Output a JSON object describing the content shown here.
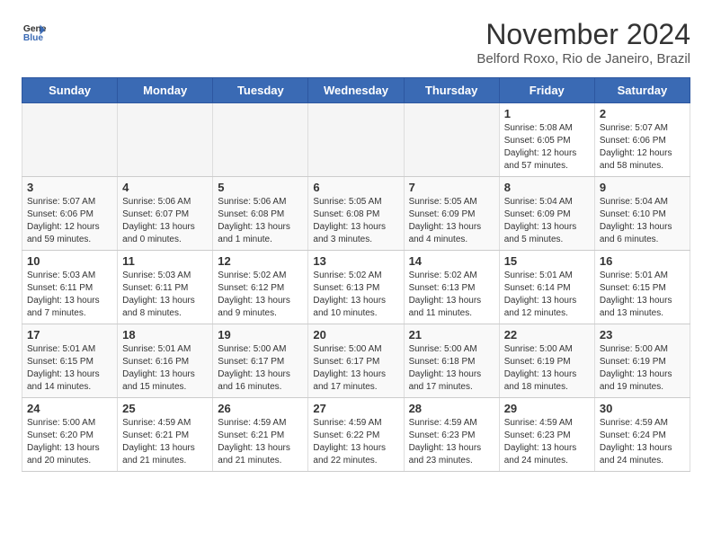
{
  "header": {
    "logo_line1": "General",
    "logo_line2": "Blue",
    "title": "November 2024",
    "subtitle": "Belford Roxo, Rio de Janeiro, Brazil"
  },
  "weekdays": [
    "Sunday",
    "Monday",
    "Tuesday",
    "Wednesday",
    "Thursday",
    "Friday",
    "Saturday"
  ],
  "weeks": [
    [
      {
        "day": "",
        "sunrise": "",
        "sunset": "",
        "daylight": "",
        "empty": true
      },
      {
        "day": "",
        "sunrise": "",
        "sunset": "",
        "daylight": "",
        "empty": true
      },
      {
        "day": "",
        "sunrise": "",
        "sunset": "",
        "daylight": "",
        "empty": true
      },
      {
        "day": "",
        "sunrise": "",
        "sunset": "",
        "daylight": "",
        "empty": true
      },
      {
        "day": "",
        "sunrise": "",
        "sunset": "",
        "daylight": "",
        "empty": true
      },
      {
        "day": "1",
        "sunrise": "Sunrise: 5:08 AM",
        "sunset": "Sunset: 6:05 PM",
        "daylight": "Daylight: 12 hours and 57 minutes.",
        "empty": false
      },
      {
        "day": "2",
        "sunrise": "Sunrise: 5:07 AM",
        "sunset": "Sunset: 6:06 PM",
        "daylight": "Daylight: 12 hours and 58 minutes.",
        "empty": false
      }
    ],
    [
      {
        "day": "3",
        "sunrise": "Sunrise: 5:07 AM",
        "sunset": "Sunset: 6:06 PM",
        "daylight": "Daylight: 12 hours and 59 minutes.",
        "empty": false
      },
      {
        "day": "4",
        "sunrise": "Sunrise: 5:06 AM",
        "sunset": "Sunset: 6:07 PM",
        "daylight": "Daylight: 13 hours and 0 minutes.",
        "empty": false
      },
      {
        "day": "5",
        "sunrise": "Sunrise: 5:06 AM",
        "sunset": "Sunset: 6:08 PM",
        "daylight": "Daylight: 13 hours and 1 minute.",
        "empty": false
      },
      {
        "day": "6",
        "sunrise": "Sunrise: 5:05 AM",
        "sunset": "Sunset: 6:08 PM",
        "daylight": "Daylight: 13 hours and 3 minutes.",
        "empty": false
      },
      {
        "day": "7",
        "sunrise": "Sunrise: 5:05 AM",
        "sunset": "Sunset: 6:09 PM",
        "daylight": "Daylight: 13 hours and 4 minutes.",
        "empty": false
      },
      {
        "day": "8",
        "sunrise": "Sunrise: 5:04 AM",
        "sunset": "Sunset: 6:09 PM",
        "daylight": "Daylight: 13 hours and 5 minutes.",
        "empty": false
      },
      {
        "day": "9",
        "sunrise": "Sunrise: 5:04 AM",
        "sunset": "Sunset: 6:10 PM",
        "daylight": "Daylight: 13 hours and 6 minutes.",
        "empty": false
      }
    ],
    [
      {
        "day": "10",
        "sunrise": "Sunrise: 5:03 AM",
        "sunset": "Sunset: 6:11 PM",
        "daylight": "Daylight: 13 hours and 7 minutes.",
        "empty": false
      },
      {
        "day": "11",
        "sunrise": "Sunrise: 5:03 AM",
        "sunset": "Sunset: 6:11 PM",
        "daylight": "Daylight: 13 hours and 8 minutes.",
        "empty": false
      },
      {
        "day": "12",
        "sunrise": "Sunrise: 5:02 AM",
        "sunset": "Sunset: 6:12 PM",
        "daylight": "Daylight: 13 hours and 9 minutes.",
        "empty": false
      },
      {
        "day": "13",
        "sunrise": "Sunrise: 5:02 AM",
        "sunset": "Sunset: 6:13 PM",
        "daylight": "Daylight: 13 hours and 10 minutes.",
        "empty": false
      },
      {
        "day": "14",
        "sunrise": "Sunrise: 5:02 AM",
        "sunset": "Sunset: 6:13 PM",
        "daylight": "Daylight: 13 hours and 11 minutes.",
        "empty": false
      },
      {
        "day": "15",
        "sunrise": "Sunrise: 5:01 AM",
        "sunset": "Sunset: 6:14 PM",
        "daylight": "Daylight: 13 hours and 12 minutes.",
        "empty": false
      },
      {
        "day": "16",
        "sunrise": "Sunrise: 5:01 AM",
        "sunset": "Sunset: 6:15 PM",
        "daylight": "Daylight: 13 hours and 13 minutes.",
        "empty": false
      }
    ],
    [
      {
        "day": "17",
        "sunrise": "Sunrise: 5:01 AM",
        "sunset": "Sunset: 6:15 PM",
        "daylight": "Daylight: 13 hours and 14 minutes.",
        "empty": false
      },
      {
        "day": "18",
        "sunrise": "Sunrise: 5:01 AM",
        "sunset": "Sunset: 6:16 PM",
        "daylight": "Daylight: 13 hours and 15 minutes.",
        "empty": false
      },
      {
        "day": "19",
        "sunrise": "Sunrise: 5:00 AM",
        "sunset": "Sunset: 6:17 PM",
        "daylight": "Daylight: 13 hours and 16 minutes.",
        "empty": false
      },
      {
        "day": "20",
        "sunrise": "Sunrise: 5:00 AM",
        "sunset": "Sunset: 6:17 PM",
        "daylight": "Daylight: 13 hours and 17 minutes.",
        "empty": false
      },
      {
        "day": "21",
        "sunrise": "Sunrise: 5:00 AM",
        "sunset": "Sunset: 6:18 PM",
        "daylight": "Daylight: 13 hours and 17 minutes.",
        "empty": false
      },
      {
        "day": "22",
        "sunrise": "Sunrise: 5:00 AM",
        "sunset": "Sunset: 6:19 PM",
        "daylight": "Daylight: 13 hours and 18 minutes.",
        "empty": false
      },
      {
        "day": "23",
        "sunrise": "Sunrise: 5:00 AM",
        "sunset": "Sunset: 6:19 PM",
        "daylight": "Daylight: 13 hours and 19 minutes.",
        "empty": false
      }
    ],
    [
      {
        "day": "24",
        "sunrise": "Sunrise: 5:00 AM",
        "sunset": "Sunset: 6:20 PM",
        "daylight": "Daylight: 13 hours and 20 minutes.",
        "empty": false
      },
      {
        "day": "25",
        "sunrise": "Sunrise: 4:59 AM",
        "sunset": "Sunset: 6:21 PM",
        "daylight": "Daylight: 13 hours and 21 minutes.",
        "empty": false
      },
      {
        "day": "26",
        "sunrise": "Sunrise: 4:59 AM",
        "sunset": "Sunset: 6:21 PM",
        "daylight": "Daylight: 13 hours and 21 minutes.",
        "empty": false
      },
      {
        "day": "27",
        "sunrise": "Sunrise: 4:59 AM",
        "sunset": "Sunset: 6:22 PM",
        "daylight": "Daylight: 13 hours and 22 minutes.",
        "empty": false
      },
      {
        "day": "28",
        "sunrise": "Sunrise: 4:59 AM",
        "sunset": "Sunset: 6:23 PM",
        "daylight": "Daylight: 13 hours and 23 minutes.",
        "empty": false
      },
      {
        "day": "29",
        "sunrise": "Sunrise: 4:59 AM",
        "sunset": "Sunset: 6:23 PM",
        "daylight": "Daylight: 13 hours and 24 minutes.",
        "empty": false
      },
      {
        "day": "30",
        "sunrise": "Sunrise: 4:59 AM",
        "sunset": "Sunset: 6:24 PM",
        "daylight": "Daylight: 13 hours and 24 minutes.",
        "empty": false
      }
    ]
  ]
}
